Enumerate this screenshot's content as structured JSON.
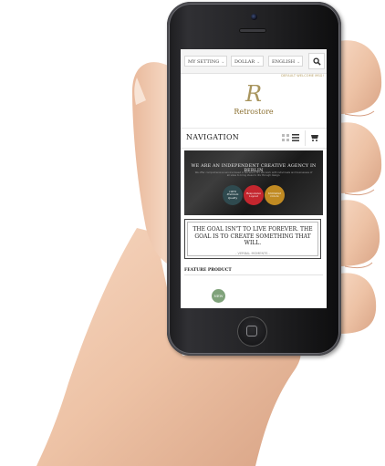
{
  "topbar": {
    "setting_label": "MY SETTING",
    "currency_label": "DOLLAR",
    "language_label": "ENGLISH"
  },
  "welcome_text": "DEFAULT WELCOME MSG!",
  "logo": {
    "letter": "R",
    "name": "Retrostore"
  },
  "navigation": {
    "title": "NAVIGATION"
  },
  "banner": {
    "title": "WE ARE AN INDEPENDENT CREATIVE AGENCY IN BERLIN",
    "subtitle": "We offer comprehensive service based in Norwood, NY. We work with individuals and businesses of all sizes to bring ideas to life through design.",
    "badges": [
      {
        "text": "100% Premium Quality",
        "color": "#2f4a4f"
      },
      {
        "text": "Responsive Layout",
        "color": "#c4262e"
      },
      {
        "text": "Unlimited Colors",
        "color": "#c08a22"
      }
    ]
  },
  "quote": {
    "text": "THE GOAL ISN'T TO LIVE FOREVER. THE GOAL IS TO CREATE SOMETHING THAT WILL.",
    "author": "- VERBAL MOMENTS -"
  },
  "feature": {
    "label": "FEATURE PRODUCT",
    "badge": "NEW"
  },
  "colors": {
    "accent": "#a8955e",
    "badge_new": "#7fa27a"
  }
}
